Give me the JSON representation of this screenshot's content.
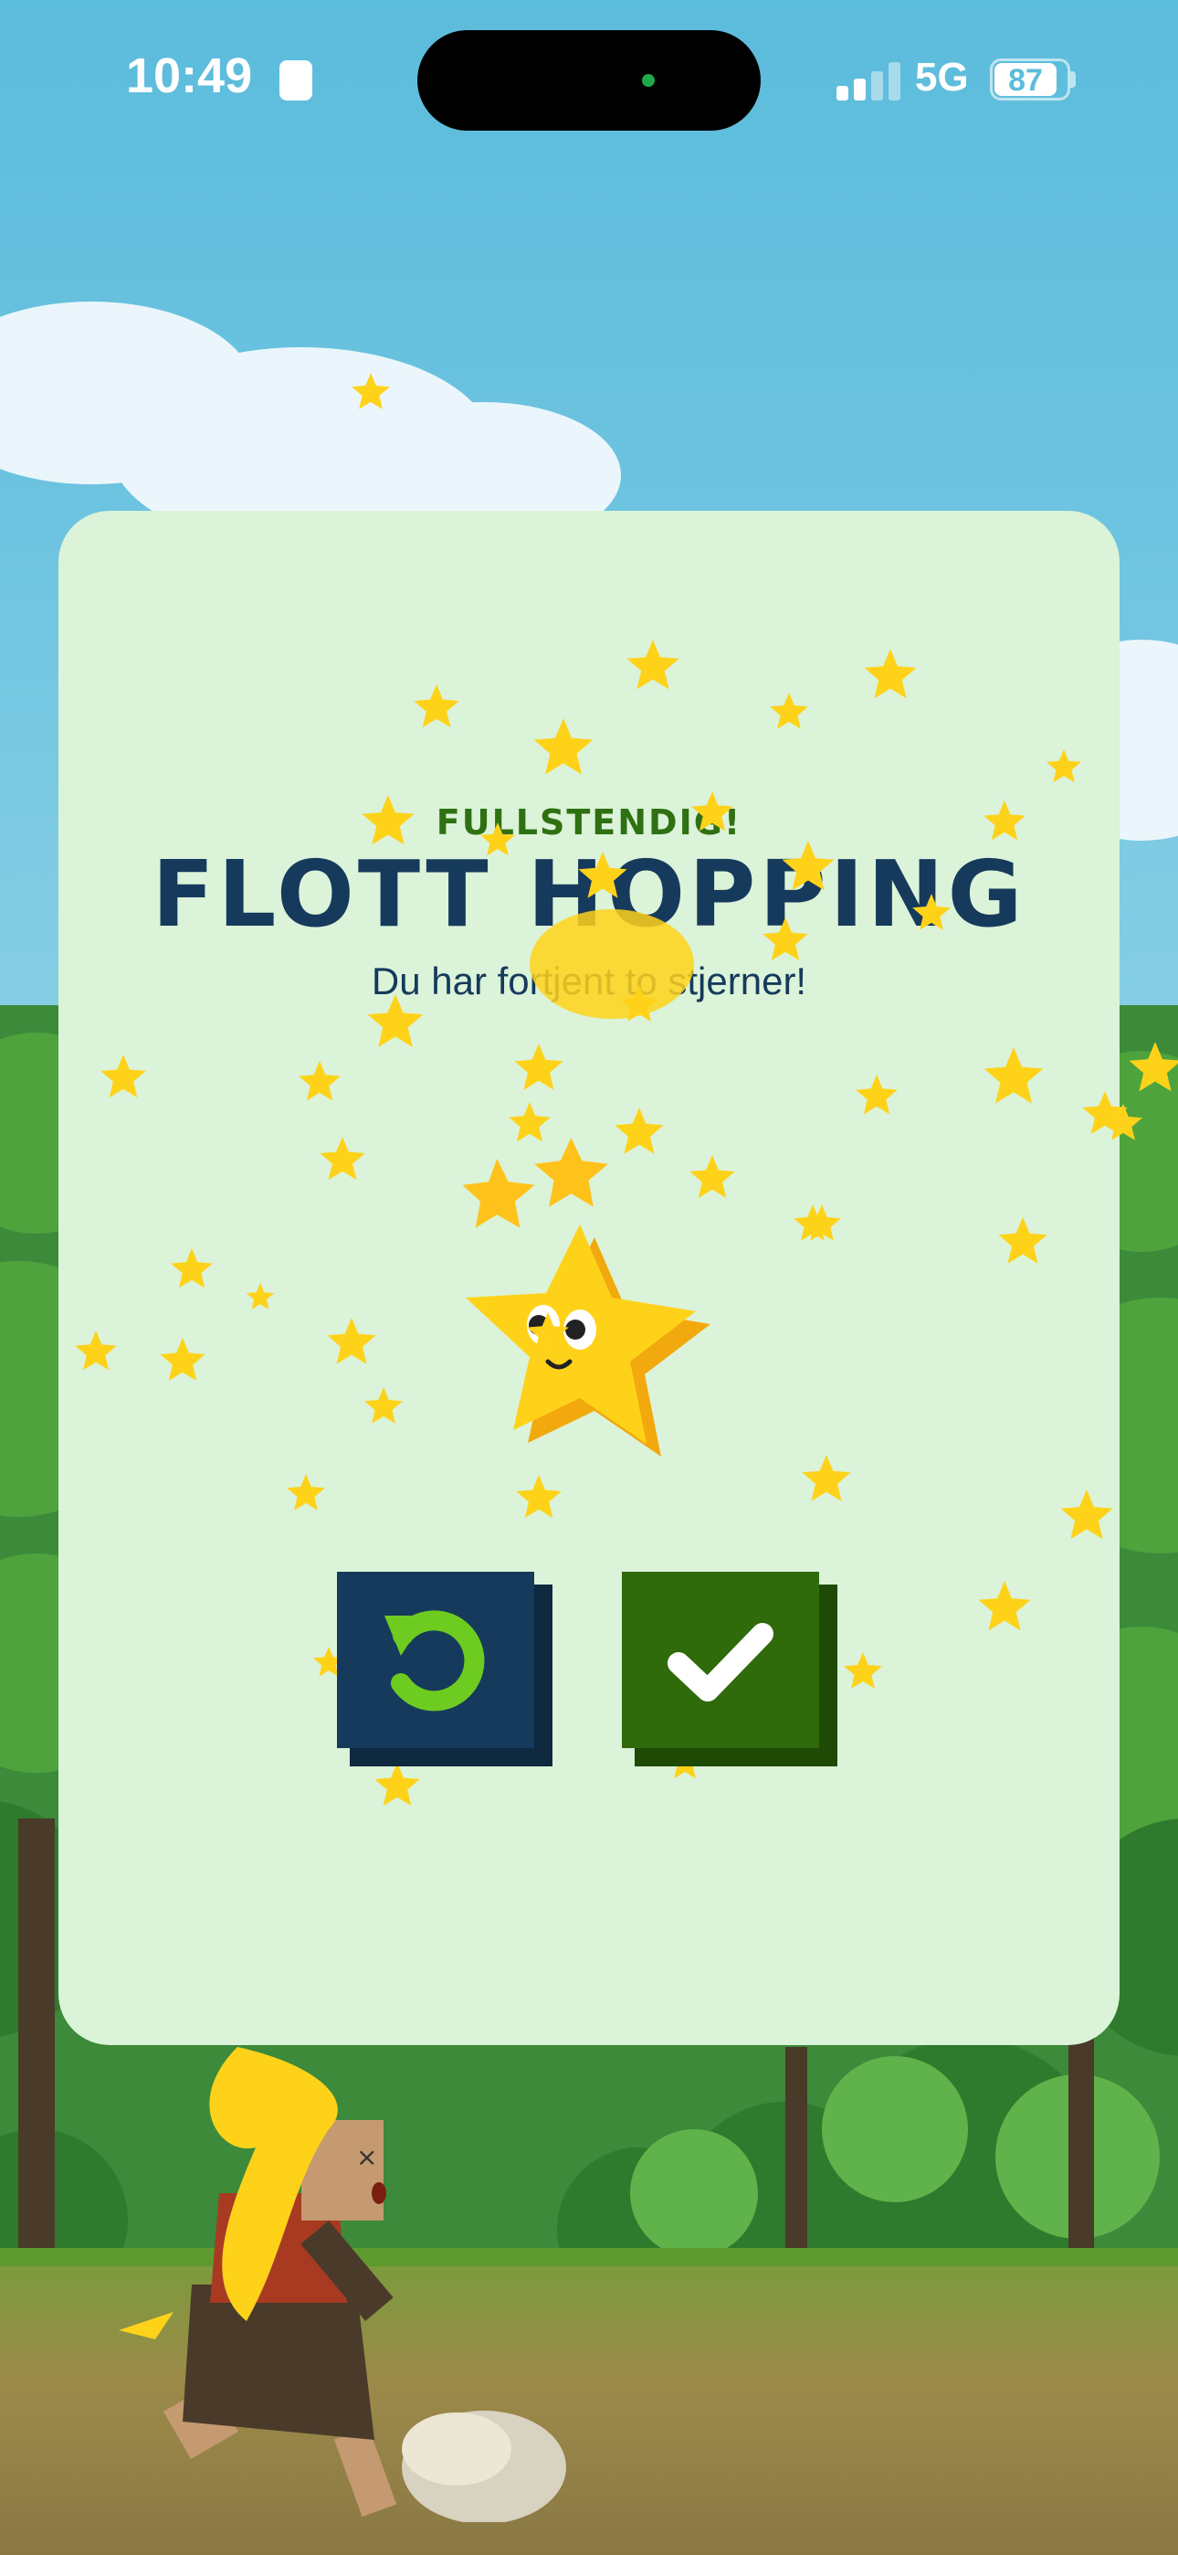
{
  "status_bar": {
    "time": "10:49",
    "network": "5G",
    "battery": "87"
  },
  "dialog": {
    "subtitle": "FULLSTENDIG!",
    "title": "FLOTT HOPPING",
    "description": "Du har fortjent to stjerner!",
    "stars_earned": 2
  },
  "buttons": {
    "retry_icon": "retry-arrow-icon",
    "confirm_icon": "checkmark-icon"
  },
  "colors": {
    "card_bg": "#dbf3d8",
    "title": "#163a5c",
    "subtitle": "#2f7012",
    "retry_button": "#163a5c",
    "confirm_button": "#2f6a0b",
    "star": "#ffd21a"
  }
}
